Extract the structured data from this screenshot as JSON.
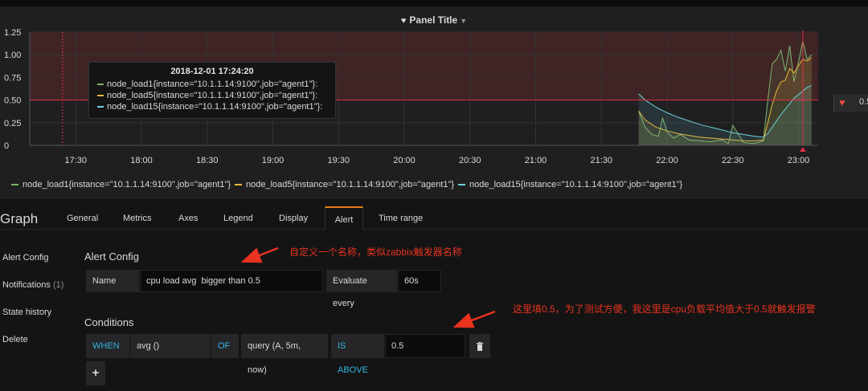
{
  "panel": {
    "title": "Panel Title",
    "title_icon": "heart-icon",
    "threshold_value": "0.5"
  },
  "chart_data": {
    "type": "line",
    "y_ticks": [
      "1.25",
      "1.00",
      "0.75",
      "0.50",
      "0.25",
      "0"
    ],
    "x_ticks": [
      "17:30",
      "18:00",
      "18:30",
      "19:00",
      "19:30",
      "20:00",
      "20:30",
      "21:00",
      "21:30",
      "22:00",
      "22:30",
      "23:00"
    ],
    "ylim": [
      0,
      1.25
    ],
    "threshold": 0.5,
    "threshold_color": "#e02f44",
    "series": [
      {
        "name": "node_load1{instance=\"10.1.1.14:9100\",job=\"agent1\"}",
        "color": "#7eb26d",
        "x": [
          "21:47",
          "21:50",
          "21:53",
          "21:56",
          "21:58",
          "22:00",
          "22:03",
          "22:06",
          "22:10",
          "22:15",
          "22:20",
          "22:25",
          "22:28",
          "22:30",
          "22:35",
          "22:40",
          "22:44",
          "22:46",
          "22:48",
          "22:50",
          "22:52",
          "22:54",
          "22:56",
          "22:58",
          "23:00",
          "23:02",
          "23:04",
          "23:06"
        ],
        "values": [
          0.38,
          0.2,
          0.12,
          0.1,
          0.3,
          0.15,
          0.08,
          0.12,
          0.06,
          0.05,
          0.04,
          0.06,
          0.02,
          0.22,
          0.03,
          0.02,
          0.05,
          0.5,
          0.9,
          0.95,
          1.05,
          0.82,
          1.1,
          0.7,
          0.92,
          1.15,
          0.95,
          1.0
        ]
      },
      {
        "name": "node_load5{instance=\"10.1.1.14:9100\",job=\"agent1\"}",
        "color": "#eab839",
        "x": [
          "21:47",
          "21:50",
          "21:55",
          "22:00",
          "22:05",
          "22:10",
          "22:15",
          "22:20",
          "22:25",
          "22:30",
          "22:35",
          "22:40",
          "22:44",
          "22:46",
          "22:48",
          "22:50",
          "22:52",
          "22:54",
          "22:56",
          "22:58",
          "23:00",
          "23:02",
          "23:04",
          "23:06"
        ],
        "values": [
          0.38,
          0.28,
          0.2,
          0.16,
          0.13,
          0.11,
          0.09,
          0.08,
          0.07,
          0.06,
          0.05,
          0.05,
          0.06,
          0.25,
          0.45,
          0.6,
          0.7,
          0.72,
          0.85,
          0.8,
          0.88,
          0.95,
          0.93,
          0.97
        ]
      },
      {
        "name": "node_load15{instance=\"10.1.1.14:9100\",job=\"agent1\"}",
        "color": "#6ed0e0",
        "x": [
          "21:47",
          "21:50",
          "21:55",
          "22:00",
          "22:05",
          "22:10",
          "22:15",
          "22:20",
          "22:25",
          "22:30",
          "22:35",
          "22:40",
          "22:44",
          "22:46",
          "22:48",
          "22:50",
          "22:52",
          "22:54",
          "22:56",
          "22:58",
          "23:00",
          "23:02",
          "23:04",
          "23:06"
        ],
        "values": [
          0.57,
          0.5,
          0.42,
          0.36,
          0.31,
          0.27,
          0.23,
          0.2,
          0.17,
          0.14,
          0.12,
          0.1,
          0.09,
          0.13,
          0.2,
          0.27,
          0.34,
          0.4,
          0.46,
          0.52,
          0.56,
          0.6,
          0.64,
          0.66
        ]
      }
    ]
  },
  "tooltip": {
    "time": "2018-12-01 17:24:20",
    "rows": [
      {
        "label": "node_load1{instance=\"10.1.1.14:9100\",job=\"agent1\"}:",
        "color": "#7eb26d"
      },
      {
        "label": "node_load5{instance=\"10.1.1.14:9100\",job=\"agent1\"}:",
        "color": "#eab839"
      },
      {
        "label": "node_load15{instance=\"10.1.1.14:9100\",job=\"agent1\"}:",
        "color": "#6ed0e0"
      }
    ]
  },
  "legend": [
    {
      "label": "node_load1{instance=\"10.1.1.14:9100\",job=\"agent1\"}",
      "color": "#7eb26d"
    },
    {
      "label": "node_load5{instance=\"10.1.1.14:9100\",job=\"agent1\"}",
      "color": "#eab839"
    },
    {
      "label": "node_load15{instance=\"10.1.1.14:9100\",job=\"agent1\"}",
      "color": "#6ed0e0"
    }
  ],
  "editor": {
    "title": "Graph",
    "tabs": [
      "General",
      "Metrics",
      "Axes",
      "Legend",
      "Display",
      "Alert",
      "Time range"
    ],
    "active_tab": "Alert",
    "sidenav": {
      "alert_config": "Alert Config",
      "notifications": "Notifications",
      "notifications_count": "(1)",
      "state_history": "State history",
      "delete": "Delete"
    },
    "alert_config": {
      "heading": "Alert Config",
      "name_label": "Name",
      "name_value": "cpu load avg  bigger than 0.5",
      "evaluate_label": "Evaluate every",
      "evaluate_value": "60s"
    },
    "conditions": {
      "heading": "Conditions",
      "when": "WHEN",
      "reducer": "avg ()",
      "of": "OF",
      "query": "query (A, 5m, now)",
      "evaluator": "IS ABOVE",
      "threshold": "0.5",
      "delete_icon": "trash-icon",
      "add_icon": "plus-icon"
    },
    "annotations": {
      "name_note": "自定义一个名称，类似zabbix触发器名称",
      "threshold_note": "这里填0.5，为了测试方便，我这里是cpu负载平均值大于0.5就触发报警",
      "color": "#e8331f"
    }
  }
}
